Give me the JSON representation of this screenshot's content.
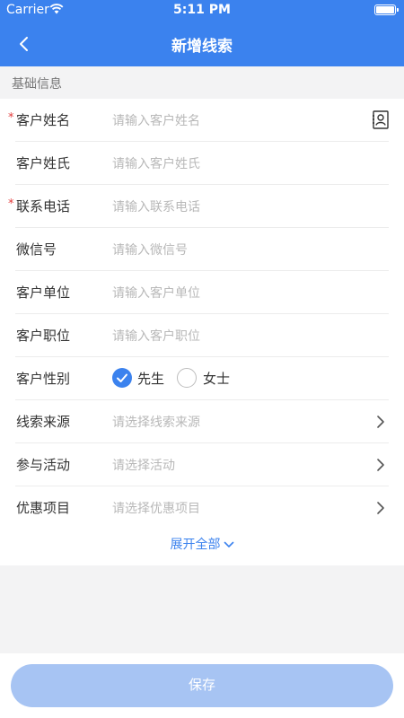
{
  "status_bar": {
    "carrier": "Carrier",
    "time": "5:11 PM"
  },
  "nav": {
    "title": "新增线索",
    "back_icon": "chevron-left-icon"
  },
  "section": {
    "title": "基础信息"
  },
  "form": {
    "rows": [
      {
        "label": "客户姓名",
        "required": "*",
        "placeholder": "请输入客户姓名",
        "icon": "contact-card-icon"
      },
      {
        "label": "客户姓氏",
        "placeholder": "请输入客户姓氏"
      },
      {
        "label": "联系电话",
        "required": "*",
        "placeholder": "请输入联系电话"
      },
      {
        "label": "微信号",
        "placeholder": "请输入微信号"
      },
      {
        "label": "客户单位",
        "placeholder": "请输入客户单位"
      },
      {
        "label": "客户职位",
        "placeholder": "请输入客户职位"
      },
      {
        "label": "客户性别",
        "options": [
          "先生",
          "女士"
        ],
        "selected": "先生"
      },
      {
        "label": "线索来源",
        "placeholder": "请选择线索来源",
        "icon": "chevron-right-icon"
      },
      {
        "label": "参与活动",
        "placeholder": "请选择活动",
        "icon": "chevron-right-icon"
      },
      {
        "label": "优惠项目",
        "placeholder": "请选择优惠项目",
        "icon": "chevron-right-icon"
      }
    ],
    "expand_label": "展开全部"
  },
  "footer": {
    "save_label": "保存"
  },
  "colors": {
    "primary": "#3b82ee",
    "save_disabled": "#a7c4f3",
    "required": "#e23a3a",
    "placeholder": "#b8b8b8"
  }
}
